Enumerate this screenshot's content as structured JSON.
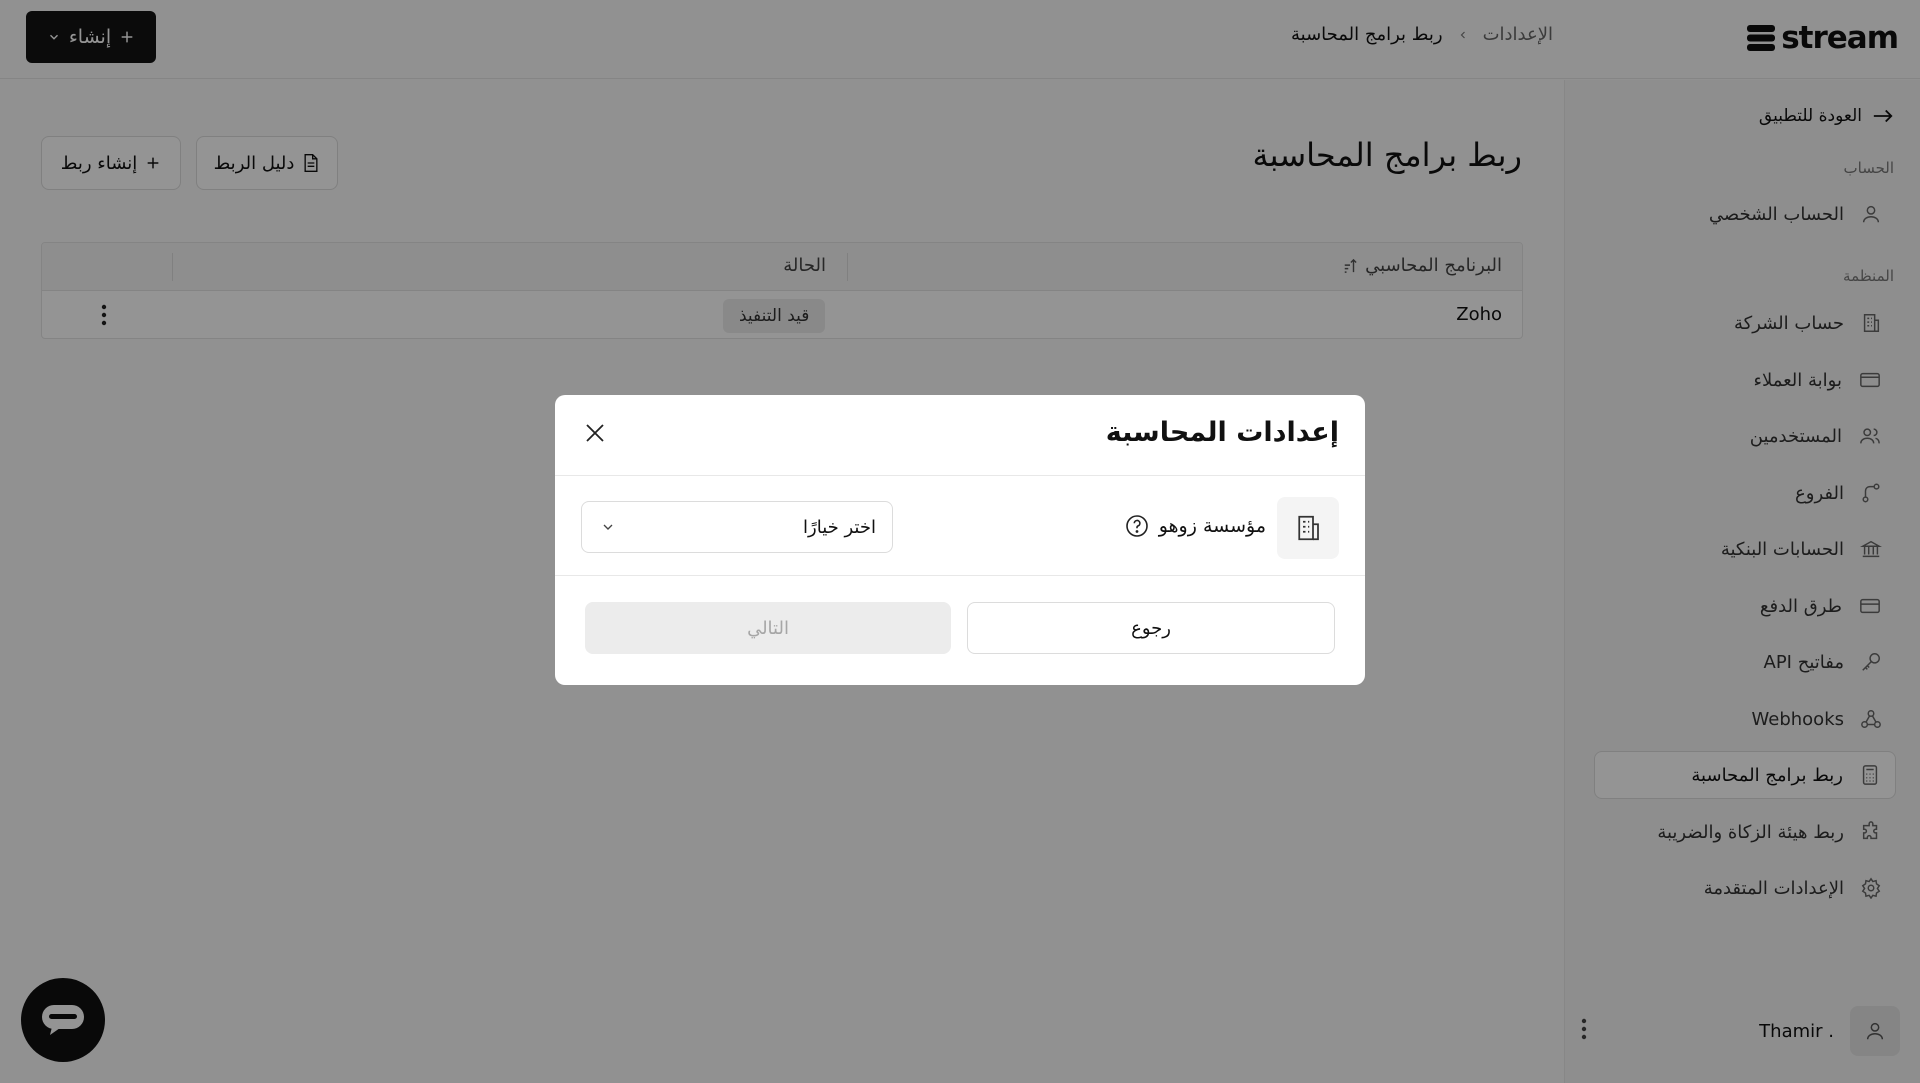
{
  "topbar": {
    "create_label": "إنشاء",
    "breadcrumb": {
      "parent": "الإعدادات",
      "current": "ربط برامج المحاسبة"
    },
    "logo_text": "stream"
  },
  "sidebar": {
    "back_label": "العودة للتطبيق",
    "section_account": "الحساب",
    "section_org": "المنظمة",
    "items": [
      {
        "label": "الحساب الشخصي",
        "icon": "user-icon"
      },
      {
        "label": "حساب الشركة",
        "icon": "building-icon"
      },
      {
        "label": "بوابة العملاء",
        "icon": "portal-icon"
      },
      {
        "label": "المستخدمين",
        "icon": "users-icon"
      },
      {
        "label": "الفروع",
        "icon": "branches-icon"
      },
      {
        "label": "الحسابات البنكية",
        "icon": "bank-icon"
      },
      {
        "label": "طرق الدفع",
        "icon": "card-icon"
      },
      {
        "label": "مفاتيح API",
        "icon": "key-icon"
      },
      {
        "label": "Webhooks",
        "icon": "webhook-icon"
      },
      {
        "label": "ربط برامج المحاسبة",
        "icon": "calculator-icon",
        "active": true
      },
      {
        "label": "ربط هيئة الزكاة والضريبة",
        "icon": "puzzle-icon"
      },
      {
        "label": "الإعدادات المتقدمة",
        "icon": "gear-icon"
      }
    ],
    "user_name": ". Thamir"
  },
  "main": {
    "title": "ربط برامج المحاسبة",
    "guide_label": "دليل الربط",
    "new_link_label": "إنشاء ربط",
    "table": {
      "col_program": "البرنامج المحاسبي",
      "col_status": "الحالة",
      "rows": [
        {
          "program": "Zoho",
          "status": "قيد التنفيذ"
        }
      ]
    }
  },
  "modal": {
    "title": "إعدادات المحاسبة",
    "org_name": "مؤسسة زوهو",
    "select_value": "اختر خيارًا",
    "back_label": "رجوع",
    "next_label": "التالي"
  },
  "colors": {
    "background": "#fafafa",
    "primary_button": "#141414",
    "overlay": "rgba(0,0,0,0.42)",
    "disabled_button": "#ececec"
  }
}
